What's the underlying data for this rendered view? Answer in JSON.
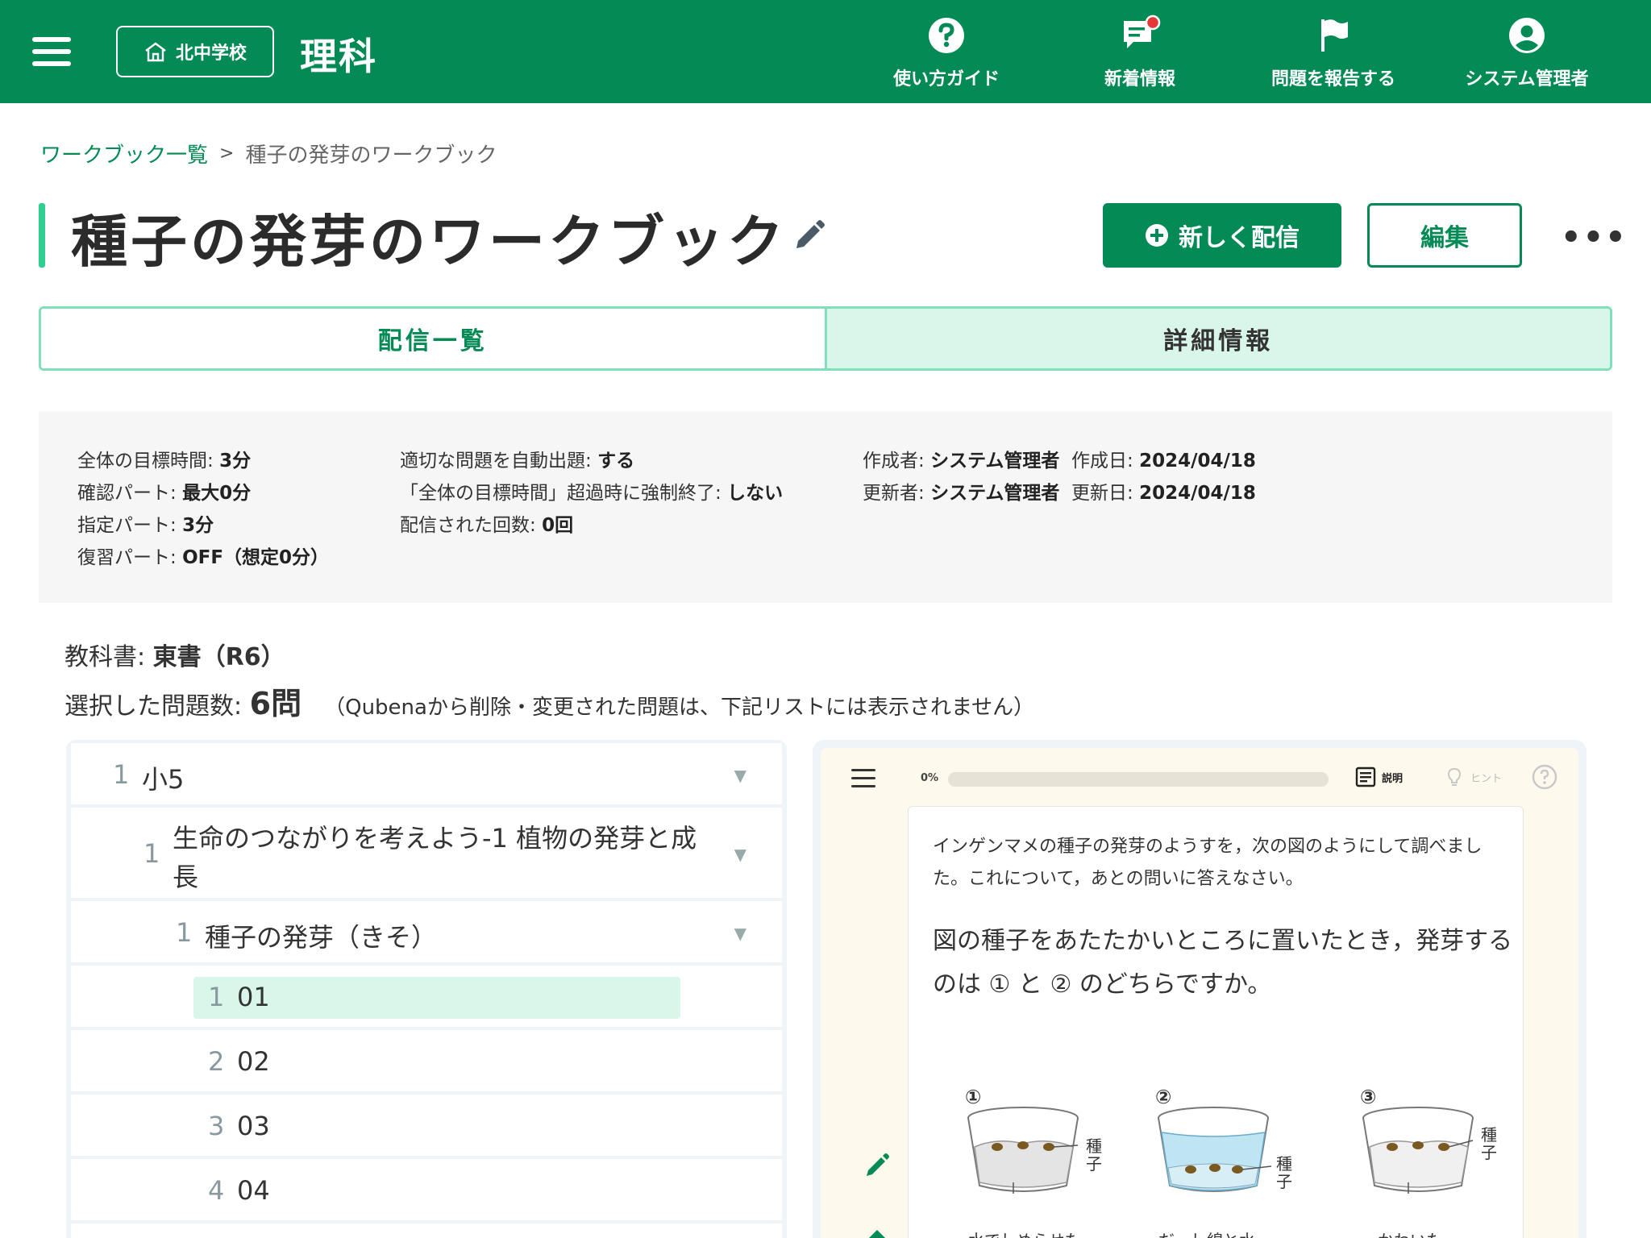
{
  "header": {
    "school": "北中学校",
    "subject": "理科",
    "nav": [
      {
        "label": "使い方ガイド",
        "icon": "help-icon"
      },
      {
        "label": "新着情報",
        "icon": "news-icon"
      },
      {
        "label": "問題を報告する",
        "icon": "flag-icon"
      },
      {
        "label": "システム管理者",
        "icon": "account-icon"
      }
    ],
    "accent": "#048a55"
  },
  "breadcrumb": {
    "parent": "ワークブック一覧",
    "separator": ">",
    "current": "種子の発芽のワークブック"
  },
  "title": "種子の発芽のワークブック",
  "actions": {
    "new_delivery": "新しく配信",
    "edit": "編集",
    "more": "•••"
  },
  "tabs": [
    {
      "label": "配信一覧"
    },
    {
      "label": "詳細情報"
    }
  ],
  "info": {
    "col1": [
      {
        "label": "全体の目標時間:",
        "value": "3分"
      },
      {
        "label": "確認パート:",
        "value": "最大0分"
      },
      {
        "label": "指定パート:",
        "value": "3分"
      },
      {
        "label": "復習パート:",
        "value": "OFF（想定0分）"
      }
    ],
    "col2": [
      {
        "label": "適切な問題を自動出題:",
        "value": "する"
      },
      {
        "label": "「全体の目標時間」超過時に強制終了:",
        "value": "しない"
      },
      {
        "label": "配信された回数:",
        "value": "0回"
      }
    ],
    "col3": [
      {
        "label": "作成者:",
        "value": "システム管理者",
        "label2": "作成日:",
        "value2": "2024/04/18"
      },
      {
        "label": "更新者:",
        "value": "システム管理者",
        "label2": "更新日:",
        "value2": "2024/04/18"
      }
    ]
  },
  "textbook": {
    "label": "教科書:",
    "value": "東書（R6）"
  },
  "count": {
    "label": "選択した問題数:",
    "value": "6問",
    "note": "（Qubenaから削除・変更された問題は、下記リストには表示されません）"
  },
  "tree": [
    {
      "num": "1",
      "text": "小5"
    },
    {
      "num": "1",
      "text1": "生命のつながりを考えよう-1  植物の発芽と成",
      "text2": "長"
    },
    {
      "num": "1",
      "text": "種子の発芽（きそ）"
    },
    {
      "num": "1",
      "text": "01"
    },
    {
      "num": "2",
      "text": "02"
    },
    {
      "num": "3",
      "text": "03"
    },
    {
      "num": "4",
      "text": "04"
    }
  ],
  "preview": {
    "progress_pct_label": "0%",
    "progress": 0,
    "explain": "説明",
    "hint": "ヒント",
    "intro": "インゲンマメの種子の発芽のようすを，次の図のようにして調べました。これについて，あとの問いに答えなさい。",
    "question": "図の種子をあたたかいところに置いたとき，発芽するのは ① と ② のどちらですか。",
    "figures": [
      {
        "mark": "①",
        "seed": "種子",
        "caption": "水でしめらせた"
      },
      {
        "mark": "②",
        "seed": "種子",
        "caption": "だっし綿と水"
      },
      {
        "mark": "③",
        "seed": "種子",
        "caption": "かわいた"
      }
    ]
  }
}
